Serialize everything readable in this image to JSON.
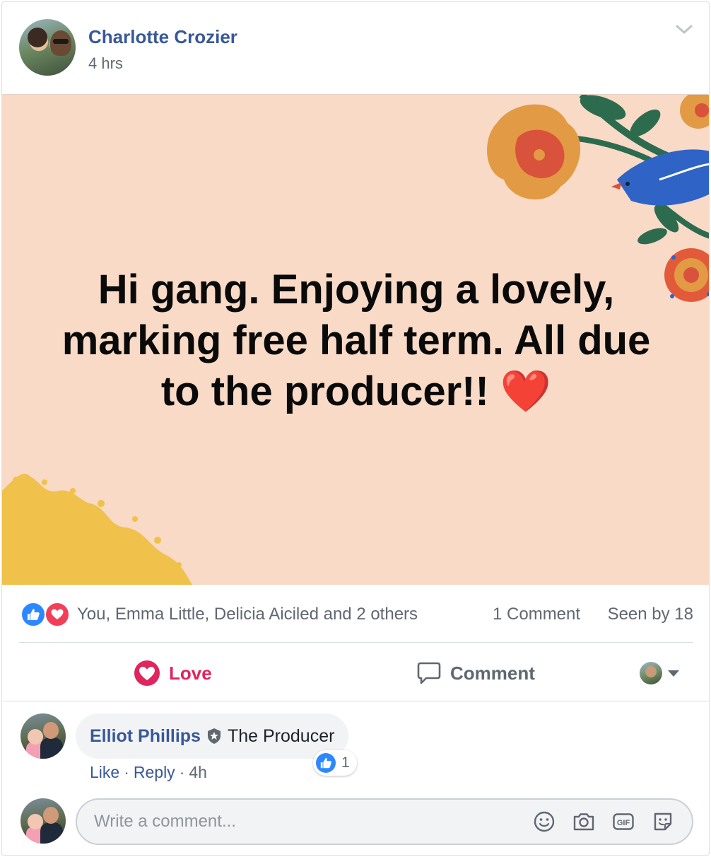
{
  "post": {
    "author": "Charlotte Crozier",
    "time": "4 hrs",
    "text": "Hi gang. Enjoying a lovely, marking free half term. All due to the producer!! ❤️",
    "background_color": "#f8dac6"
  },
  "summary": {
    "reactions": [
      "like",
      "love"
    ],
    "reactors": "You, Emma Little, Delicia Aiciled and 2 others",
    "comments_count": "1 Comment",
    "seen_by": "Seen by 18"
  },
  "actions": {
    "love_label": "Love",
    "comment_label": "Comment"
  },
  "comment": {
    "author": "Elliot Phillips",
    "role": "The Producer",
    "reaction_count": "1",
    "like_label": "Like",
    "reply_label": "Reply",
    "sep": "·",
    "time": "4h"
  },
  "composer": {
    "placeholder": "Write a comment...",
    "tools": [
      "emoji-icon",
      "camera-icon",
      "gif-icon",
      "sticker-icon"
    ]
  },
  "colors": {
    "link": "#385898",
    "love": "#e0245e",
    "like": "#2d88ff",
    "muted": "#606770"
  }
}
